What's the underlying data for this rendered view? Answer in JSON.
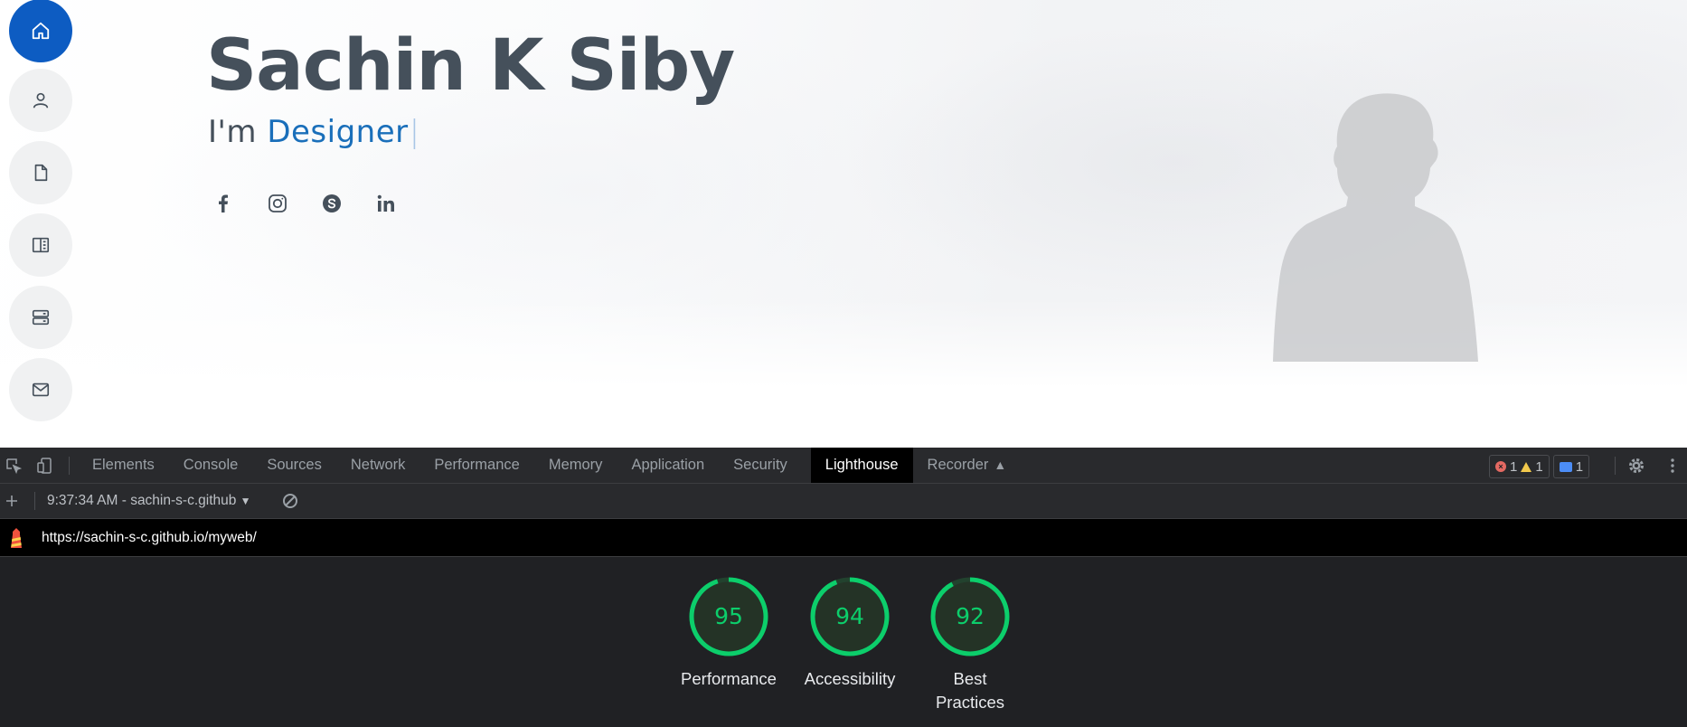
{
  "site": {
    "name": "Sachin K Siby",
    "tagline_prefix": "I'm ",
    "tagline_typed": "Designer",
    "tagline_cursor": "|",
    "nav": [
      "home-icon",
      "person-icon",
      "file-icon",
      "book-icon",
      "server-icon",
      "mail-icon"
    ],
    "socials": [
      "facebook-icon",
      "instagram-icon",
      "skype-icon",
      "linkedin-icon"
    ],
    "colors": {
      "accent": "#0d5cc2",
      "heading": "#45505b",
      "typed": "#1a6fba"
    }
  },
  "devtools": {
    "tabs": [
      "Elements",
      "Console",
      "Sources",
      "Network",
      "Performance",
      "Memory",
      "Application",
      "Security"
    ],
    "active_tab": "Lighthouse",
    "recorder_tab": "Recorder",
    "badges": {
      "errors": "1",
      "warnings": "1",
      "messages": "1"
    },
    "report_selector": "9:37:34 AM - sachin-s-c.github",
    "url": "https://sachin-s-c.github.io/myweb/",
    "scores": [
      {
        "label": "Performance",
        "value": 95
      },
      {
        "label": "Accessibility",
        "value": 94
      },
      {
        "label": "Best Practices",
        "value": 92
      }
    ],
    "colors": {
      "pass": "#0cce6b",
      "panel": "#202124"
    }
  }
}
